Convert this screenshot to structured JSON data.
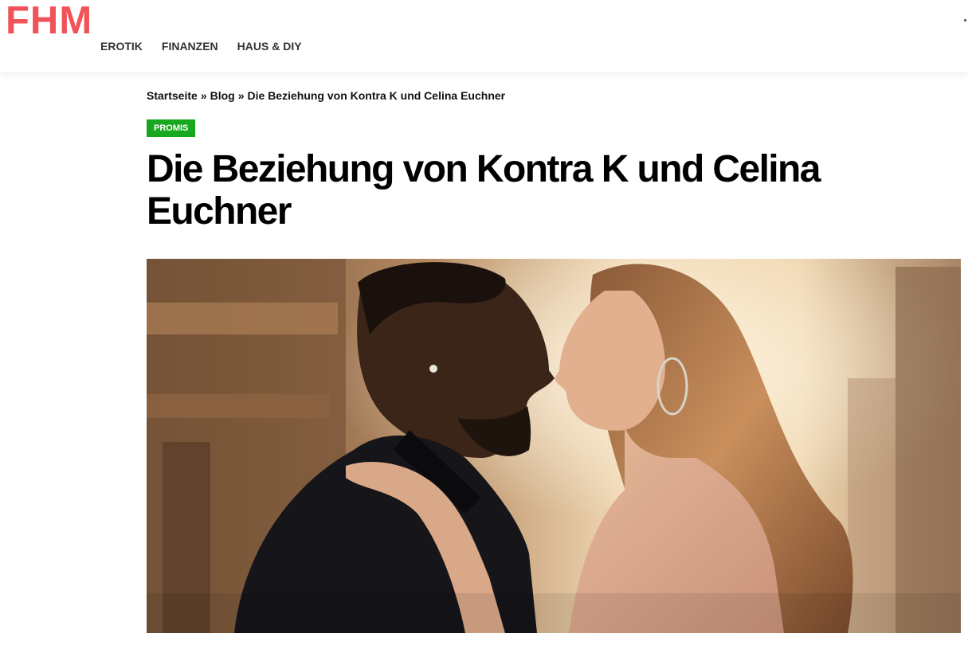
{
  "header": {
    "logo": "FHM",
    "nav": [
      {
        "label": "EROTIK"
      },
      {
        "label": "FINANZEN"
      },
      {
        "label": "HAUS & DIY"
      }
    ]
  },
  "breadcrumb": {
    "items": [
      "Startseite",
      "Blog",
      "Die Beziehung von Kontra K und Celina Euchner"
    ],
    "separator": "»"
  },
  "article": {
    "category": "PROMIS",
    "category_color": "#17a81f",
    "title": "Die Beziehung von Kontra K und Celina Euchner"
  },
  "colors": {
    "brand": "#f0535a"
  }
}
